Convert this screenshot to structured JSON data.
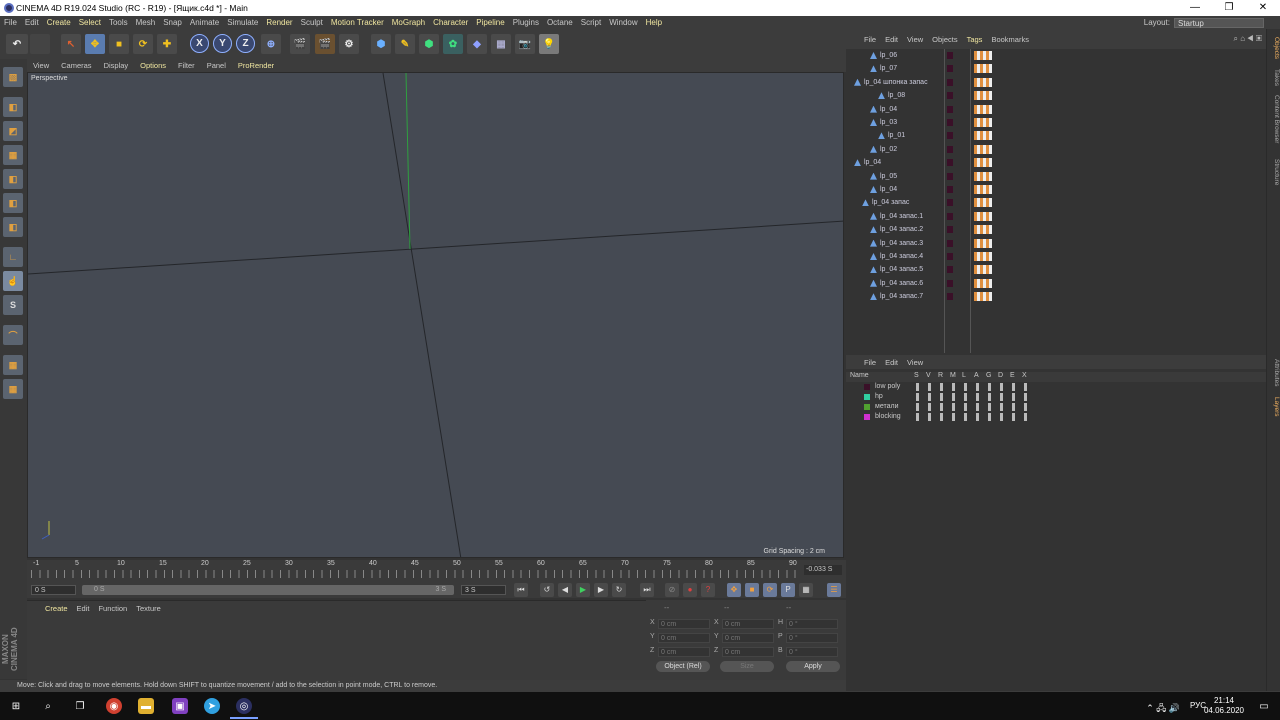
{
  "window": {
    "title": "CINEMA 4D R19.024 Studio (RC - R19) - [Ящик.c4d *] - Main",
    "min": "—",
    "max": "❐",
    "close": "✕"
  },
  "menubar": {
    "items": [
      "File",
      "Edit",
      "Create",
      "Select",
      "Tools",
      "Mesh",
      "Snap",
      "Animate",
      "Simulate",
      "Render",
      "Sculpt",
      "Motion Tracker",
      "MoGraph",
      "Character",
      "Pipeline",
      "Plugins",
      "Octane",
      "Script",
      "Window",
      "Help"
    ],
    "highlighted": [
      "Create",
      "Select",
      "Render",
      "Motion Tracker",
      "MoGraph",
      "Character",
      "Pipeline",
      "Help"
    ],
    "layout_label": "Layout:",
    "layout_value": "Startup"
  },
  "viewport": {
    "menu": [
      "View",
      "Cameras",
      "Display",
      "Options",
      "Filter",
      "Panel",
      "ProRender"
    ],
    "highlighted": [
      "Options",
      "ProRender"
    ],
    "label": "Perspective",
    "grid_spacing": "Grid Spacing : 2 cm"
  },
  "timeline": {
    "ticks": [
      "-1",
      "5",
      "10",
      "15",
      "20",
      "25",
      "30",
      "35",
      "40",
      "45",
      "50",
      "55",
      "60",
      "65",
      "70",
      "75",
      "80",
      "85",
      "90"
    ],
    "current": "-0.033 S",
    "start_field": "0 S",
    "range_start": "0 S",
    "range_end": "3 S",
    "end_field": "3 S"
  },
  "material": {
    "menu": [
      "Create",
      "Edit",
      "Function",
      "Texture"
    ]
  },
  "coords": {
    "headers": [
      "--",
      "--",
      "--"
    ],
    "rows": [
      {
        "a": "X",
        "av": "0 cm",
        "b": "X",
        "bv": "0 cm",
        "c": "H",
        "cv": "0 °"
      },
      {
        "a": "Y",
        "av": "0 cm",
        "b": "Y",
        "bv": "0 cm",
        "c": "P",
        "cv": "0 °"
      },
      {
        "a": "Z",
        "av": "0 cm",
        "b": "Z",
        "bv": "0 cm",
        "c": "B",
        "cv": "0 °"
      }
    ],
    "mode": "Object (Rel)",
    "size": "Size",
    "apply": "Apply"
  },
  "maxon": "MAXON CINEMA 4D",
  "status": "Move: Click and drag to move elements. Hold down SHIFT to quantize movement / add to the selection in point mode, CTRL to remove.",
  "objmgr": {
    "menu": [
      "File",
      "Edit",
      "View",
      "Objects",
      "Tags",
      "Bookmarks"
    ],
    "highlighted": [
      "Tags"
    ],
    "rows": [
      {
        "name": "lp_06",
        "indent": 2
      },
      {
        "name": "lp_07",
        "indent": 2
      },
      {
        "name": "lp_04 шпонка запас",
        "indent": 0
      },
      {
        "name": "lp_08",
        "indent": 3
      },
      {
        "name": "lp_04",
        "indent": 2
      },
      {
        "name": "lp_03",
        "indent": 2
      },
      {
        "name": "lp_01",
        "indent": 3
      },
      {
        "name": "lp_02",
        "indent": 2
      },
      {
        "name": "lp_04",
        "indent": 0
      },
      {
        "name": "lp_05",
        "indent": 2
      },
      {
        "name": "lp_04",
        "indent": 2
      },
      {
        "name": "lp_04 запас",
        "indent": 1
      },
      {
        "name": "lp_04 запас.1",
        "indent": 2
      },
      {
        "name": "lp_04 запас.2",
        "indent": 2
      },
      {
        "name": "lp_04 запас.3",
        "indent": 2
      },
      {
        "name": "lp_04 запас.4",
        "indent": 2
      },
      {
        "name": "lp_04 запас.5",
        "indent": 2
      },
      {
        "name": "lp_04 запас.6",
        "indent": 2
      },
      {
        "name": "lp_04 запас.7",
        "indent": 2
      }
    ]
  },
  "layermgr": {
    "menu": [
      "File",
      "Edit",
      "View"
    ],
    "columns": [
      "Name",
      "S",
      "V",
      "R",
      "M",
      "L",
      "A",
      "G",
      "D",
      "E",
      "X"
    ],
    "rows": [
      {
        "name": "low poly",
        "color": "#3a1028"
      },
      {
        "name": "hp",
        "color": "#30d0a0"
      },
      {
        "name": "метали",
        "color": "#50a030"
      },
      {
        "name": "blocking",
        "color": "#d030d0"
      }
    ]
  },
  "sidetabs": [
    {
      "label": "Objects",
      "hl": true
    },
    {
      "label": "Takes",
      "hl": false
    },
    {
      "label": "Content Browser",
      "hl": false
    },
    {
      "label": "Structure",
      "hl": false
    },
    {
      "label": "Attributes",
      "hl": false
    },
    {
      "label": "Layers",
      "hl": true
    }
  ],
  "taskbar": {
    "lang": "РУС",
    "time": "21:14",
    "date": "04.06.2020"
  }
}
